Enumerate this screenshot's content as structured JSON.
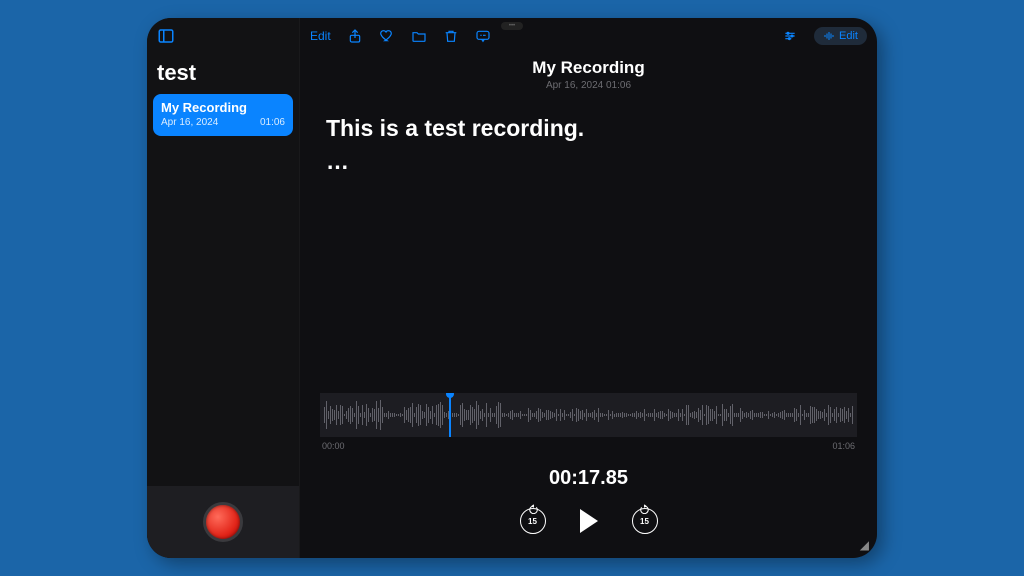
{
  "toolbar": {
    "edit_left_label": "Edit",
    "edit_right_label": "Edit"
  },
  "sidebar": {
    "title": "test",
    "items": [
      {
        "title": "My Recording",
        "date": "Apr 16, 2024",
        "duration": "01:06"
      }
    ]
  },
  "header": {
    "title": "My Recording",
    "sub": "Apr 16, 2024  01:06"
  },
  "transcript": {
    "line1": "This is a test recording.",
    "line2": "…"
  },
  "waveform": {
    "start_label": "00:00",
    "end_label": "01:06"
  },
  "playback": {
    "current_time": "00:17.85",
    "skip_back_label": "15",
    "skip_fwd_label": "15"
  }
}
